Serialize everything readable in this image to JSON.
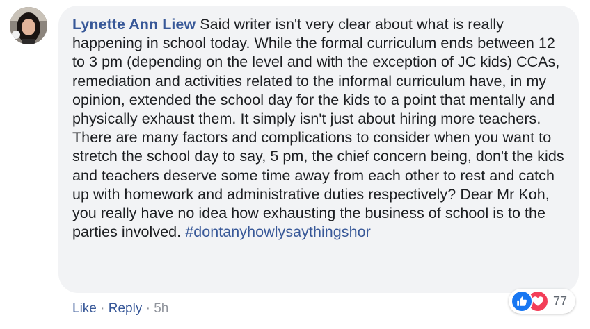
{
  "comment": {
    "author": "Lynette Ann Liew",
    "body": " Said writer isn't very clear about what is really happening in school today. While the formal curriculum ends between 12 to 3 pm (depending on the level and with the exception of JC kids) CCAs, remediation and activities related to the informal curriculum have, in my opinion, extended the school day for the kids to a point that mentally and physically exhaust them. It simply isn't just about hiring more teachers. There are many factors and complications to consider when you want to stretch the school day to say, 5 pm, the chief concern being, don't the kids and teachers deserve some time away from each other to rest and catch up with homework and administrative duties respectively? Dear Mr Koh, you really have no idea how exhausting the business of school is to the parties involved. ",
    "hashtag": "#dontanyhowlysaythingshor"
  },
  "actions": {
    "like": "Like",
    "reply": "Reply",
    "separator": " · ",
    "time": "5h"
  },
  "reactions": {
    "count": "77",
    "icons": [
      "like-icon",
      "love-icon"
    ]
  },
  "colors": {
    "link": "#385898",
    "bubble": "#f2f3f5",
    "text": "#1c1e21",
    "muted": "#90949c",
    "like": "#1877f2",
    "love": "#f33e58"
  }
}
